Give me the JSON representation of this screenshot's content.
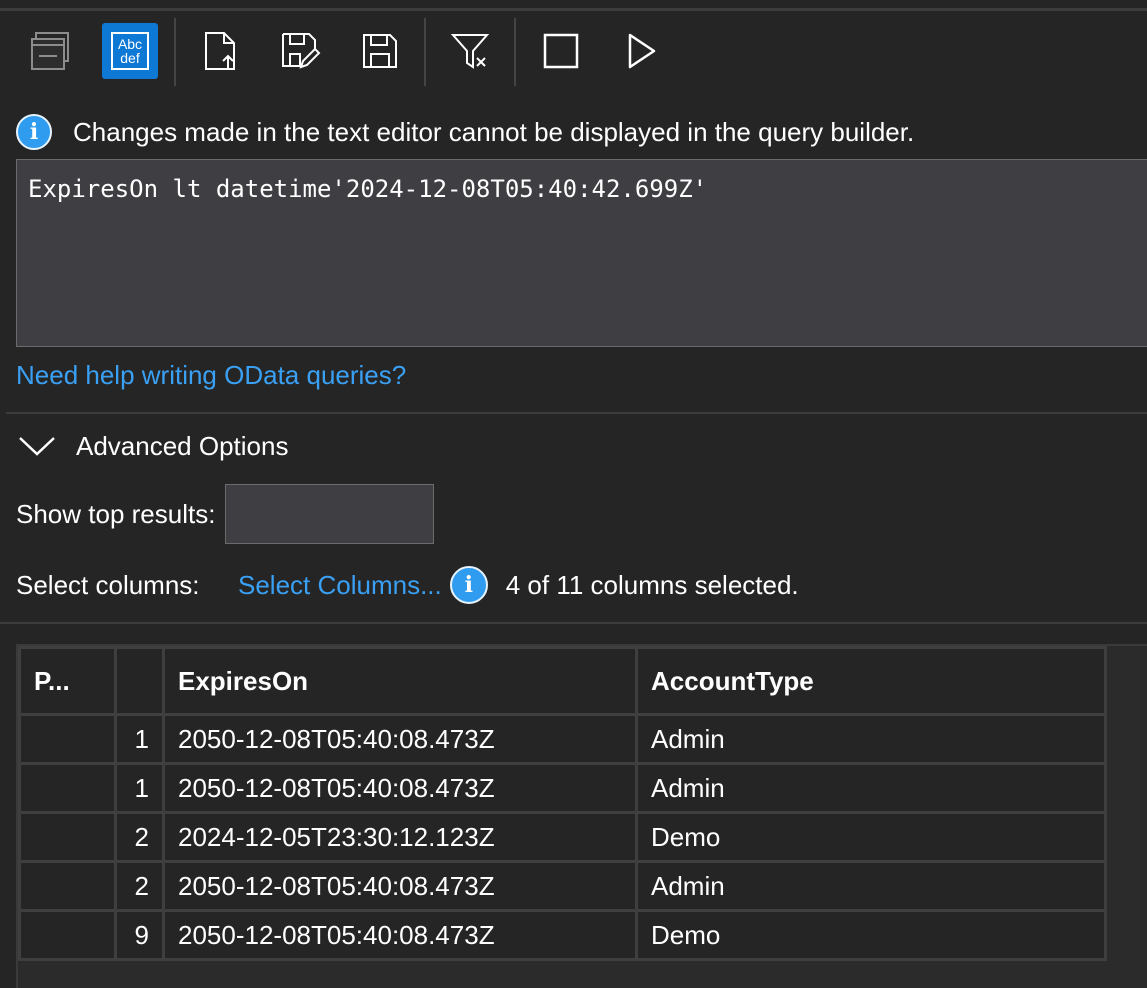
{
  "toolbar": {
    "buttons": [
      {
        "icon": "query-builder-icon",
        "active": false
      },
      {
        "icon": "text-editor-icon",
        "text": "Abc def",
        "active": true
      },
      {
        "icon": "open-query-icon",
        "active": false
      },
      {
        "icon": "save-as-icon",
        "active": false
      },
      {
        "icon": "save-icon",
        "active": false
      },
      {
        "icon": "clear-filter-icon",
        "active": false
      },
      {
        "icon": "stop-icon",
        "active": false
      },
      {
        "icon": "run-icon",
        "active": false
      }
    ],
    "abc_line1": "Abc",
    "abc_line2": "def"
  },
  "info_banner": {
    "icon": "i",
    "text": "Changes made in the text editor cannot be displayed in the query builder."
  },
  "editor": {
    "query_text": "ExpiresOn lt datetime'2024-12-08T05:40:42.699Z'"
  },
  "help_link": "Need help writing OData queries?",
  "advanced_options": {
    "label": "Advanced Options",
    "expanded": true,
    "show_top_label": "Show top results:",
    "show_top_value": "",
    "select_columns_label": "Select columns:",
    "select_columns_link": "Select Columns...",
    "info_icon": "i",
    "columns_selected_text": "4 of 11 columns selected."
  },
  "grid": {
    "columns": [
      "P...",
      "",
      "ExpiresOn",
      "AccountType"
    ],
    "rows": [
      [
        "",
        "1",
        "2050-12-08T05:40:08.473Z",
        "Admin"
      ],
      [
        "",
        "1",
        "2050-12-08T05:40:08.473Z",
        "Admin"
      ],
      [
        "",
        "2",
        "2024-12-05T23:30:12.123Z",
        "Demo"
      ],
      [
        "",
        "2",
        "2050-12-08T05:40:08.473Z",
        "Admin"
      ],
      [
        "",
        "9",
        "2050-12-08T05:40:08.473Z",
        "Demo"
      ]
    ]
  },
  "colors": {
    "background": "#252526",
    "accent": "#0e78d5",
    "link": "#3aa0f3",
    "info_icon": "#2f9cf0"
  }
}
